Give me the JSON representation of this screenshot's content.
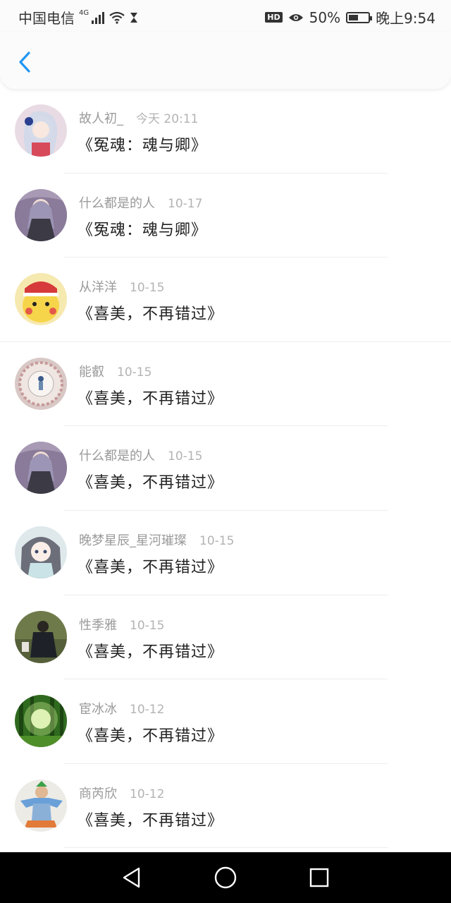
{
  "status_bar": {
    "carrier": "中国电信",
    "network": "4G",
    "hd": "HD",
    "battery_percent": "50%",
    "battery_level": 0.5,
    "time": "晚上9:54",
    "icons": [
      "signal-icon",
      "wifi-icon",
      "hourglass-icon",
      "eye-icon",
      "battery-icon"
    ]
  },
  "header": {
    "back_icon": "chevron-left-icon",
    "accent": "#2196F3"
  },
  "comments": [
    {
      "name": "故人初_",
      "date": "今天 20:11",
      "title": "《冤魂：魂与卿》"
    },
    {
      "name": "什么都是的人",
      "date": "10-17",
      "title": "《冤魂：魂与卿》"
    },
    {
      "name": "从洋洋",
      "date": "10-15",
      "title": "《喜美，不再错过》"
    },
    {
      "name": "能叡",
      "date": "10-15",
      "title": "《喜美，不再错过》"
    },
    {
      "name": "什么都是的人",
      "date": "10-15",
      "title": "《喜美，不再错过》"
    },
    {
      "name": "晚梦星辰_星河璀璨",
      "date": "10-15",
      "title": "《喜美，不再错过》"
    },
    {
      "name": "性季雅",
      "date": "10-15",
      "title": "《喜美，不再错过》"
    },
    {
      "name": "宦冰冰",
      "date": "10-12",
      "title": "《喜美，不再错过》"
    },
    {
      "name": "商芮欣",
      "date": "10-12",
      "title": "《喜美，不再错过》"
    }
  ],
  "nav_bar": {
    "buttons": [
      "back-triangle-icon",
      "home-circle-icon",
      "recents-square-icon"
    ]
  }
}
